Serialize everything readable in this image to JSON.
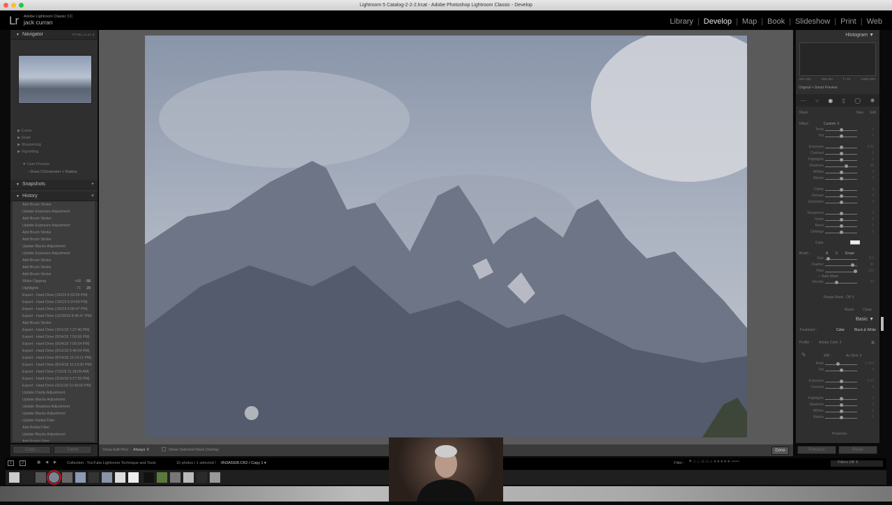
{
  "window": {
    "title": "Lightroom 5 Catalog-2-2-2.lrcat - Adobe Photoshop Lightroom Classic - Develop"
  },
  "identity": {
    "logo": "Lr",
    "app": "Adobe Lightroom Classic CC",
    "user": "jack curran"
  },
  "modules": [
    {
      "label": "Library"
    },
    {
      "label": "Develop",
      "active": true
    },
    {
      "label": "Map"
    },
    {
      "label": "Book"
    },
    {
      "label": "Slideshow"
    },
    {
      "label": "Print"
    },
    {
      "label": "Web"
    }
  ],
  "left": {
    "navigator": {
      "title": "Navigator",
      "zoom_options": "FIT  FILL  1:1  4:1 ⇕"
    },
    "sections": [
      "Curve",
      "Grain",
      "Sharpening",
      "Vignetting"
    ],
    "user_presets": {
      "title": "User Presets",
      "item": "Dune COnversion + Radius"
    },
    "snapshots": {
      "title": "Snapshots",
      "add": "+"
    },
    "history": {
      "title": "History",
      "close": "×",
      "items": [
        {
          "label": "Add Brush Stroke"
        },
        {
          "label": "Update Exposure Adjustment"
        },
        {
          "label": "Add Brush Stroke"
        },
        {
          "label": "Update Exposure Adjustment"
        },
        {
          "label": "Add Brush Stroke"
        },
        {
          "label": "Add Brush Stroke"
        },
        {
          "label": "Update Blacks Adjustment"
        },
        {
          "label": "Update Exposure Adjustment"
        },
        {
          "label": "Add Brush Stroke"
        },
        {
          "label": "Add Brush Stroke"
        },
        {
          "label": "Add Brush Stroke"
        },
        {
          "label": "White Clipping",
          "v1": "+68",
          "v2": "68"
        },
        {
          "label": "Highlights",
          "v1": "-71",
          "v2": "29"
        },
        {
          "label": "Export - Hard Drive (1/6/19 6:32:05 PM)"
        },
        {
          "label": "Export - Hard Drive (1/6/19 6:24:59 PM)"
        },
        {
          "label": "Export - Hard Drive (1/6/19 5:06:47 PM)"
        },
        {
          "label": "Export - Hard Drive (12/28/18 8:46:47 PM)"
        },
        {
          "label": "Add Brush Stroke"
        },
        {
          "label": "Export - Hard Drive (10/1/18 7:27:40 PM)"
        },
        {
          "label": "Export - Hard Drive (9/24/18 7:56:56 PM)"
        },
        {
          "label": "Export - Hard Drive (9/24/18 7:05:54 PM)"
        },
        {
          "label": "Export - Hard Drive (9/12/18 6:46:04 PM)"
        },
        {
          "label": "Export - Hard Drive (8/14/18 10:14:11 PM)"
        },
        {
          "label": "Export - Hard Drive (8/14/18 10:13:50 PM)"
        },
        {
          "label": "Export - Hard Drive (7/2/18 11:18:04 AM)"
        },
        {
          "label": "Export - Hard Drive (3/16/18 5:27:59 PM)"
        },
        {
          "label": "Export - Hard Drive (3/11/18 11:43:02 PM)"
        },
        {
          "label": "Update Clarity Adjustment"
        },
        {
          "label": "Update Blacks Adjustment"
        },
        {
          "label": "Update Shadows Adjustment"
        },
        {
          "label": "Update Blacks Adjustment"
        },
        {
          "label": "Update Radial Filter"
        },
        {
          "label": "Add Radial Filter"
        },
        {
          "label": "Update Blacks Adjustment"
        },
        {
          "label": "Add Radial Filter"
        }
      ]
    },
    "copy": "Copy...",
    "paste": "Paste"
  },
  "toolbar": {
    "edit_pins_label": "Show Edit Pins :",
    "edit_pins_value": "Always ⇕",
    "mask_overlay": "Show Selected Mask Overlay",
    "done": "Done"
  },
  "right": {
    "histogram": {
      "title": "Histogram",
      "iso": "ISO 100",
      "focal": "158 mm",
      "aperture": "f / 10",
      "shutter": "1/400 SEC",
      "preview": "Original + Smart Preview"
    },
    "mask": {
      "label": "Mask :",
      "new": "New",
      "edit": "Edit"
    },
    "effect": {
      "label": "Effect :",
      "value": "Custom ⇕"
    },
    "sliders": [
      {
        "label": "Temp",
        "pos": 0.5,
        "value": "0"
      },
      {
        "label": "Tint",
        "pos": 0.5,
        "value": "0"
      },
      {
        "label": "Exposure",
        "pos": 0.5,
        "value": "0.00"
      },
      {
        "label": "Contrast",
        "pos": 0.5,
        "value": "0"
      },
      {
        "label": "Highlights",
        "pos": 0.5,
        "value": "0"
      },
      {
        "label": "Shadows",
        "pos": 0.66,
        "value": "38"
      },
      {
        "label": "Whites",
        "pos": 0.5,
        "value": "0"
      },
      {
        "label": "Blacks",
        "pos": 0.5,
        "value": "0"
      },
      {
        "label": "Clarity",
        "pos": 0.5,
        "value": "0"
      },
      {
        "label": "Dehaze",
        "pos": 0.5,
        "value": "0"
      },
      {
        "label": "Saturation",
        "pos": 0.5,
        "value": "0"
      },
      {
        "label": "Sharpness",
        "pos": 0.5,
        "value": "0"
      },
      {
        "label": "Noise",
        "pos": 0.5,
        "value": "0"
      },
      {
        "label": "Moiré",
        "pos": 0.5,
        "value": "0"
      },
      {
        "label": "Defringe",
        "pos": 0.5,
        "value": "0"
      }
    ],
    "color_label": "Color",
    "brush": {
      "label": "Brush :",
      "a": "A",
      "b": "B",
      "erase": "Erase",
      "auto_mask": "Auto Mask",
      "sliders": [
        {
          "label": "Size",
          "pos": 0.1,
          "value": "8.6"
        },
        {
          "label": "Feather",
          "pos": 0.85,
          "value": "90"
        },
        {
          "label": "Flow",
          "pos": 0.95,
          "value": "100"
        },
        {
          "label": "Density",
          "pos": 0.35,
          "value": "33"
        }
      ]
    },
    "range_mask": "Range Mask : Off ⇕",
    "reset": "Reset",
    "close": "Close",
    "basic": {
      "title": "Basic",
      "treatment_label": "Treatment :",
      "color": "Color",
      "bw": "Black & White",
      "profile_label": "Profile :",
      "profile": "Adobe Color ⇕",
      "wb_label": "WB :",
      "wb": "As Shot ⇕",
      "tone": "Tone",
      "auto": "Auto",
      "presence": "Presence",
      "sliders": [
        {
          "label": "Temp",
          "pos": 0.4,
          "value": "5,200"
        },
        {
          "label": "Tint",
          "pos": 0.5,
          "value": "0"
        },
        {
          "label": "Exposure",
          "pos": 0.5,
          "value": "0.00"
        },
        {
          "label": "Contrast",
          "pos": 0.5,
          "value": "0"
        },
        {
          "label": "Highlights",
          "pos": 0.5,
          "value": "0"
        },
        {
          "label": "Shadows",
          "pos": 0.5,
          "value": "0"
        },
        {
          "label": "Whites",
          "pos": 0.5,
          "value": "0"
        },
        {
          "label": "Blacks",
          "pos": 0.5,
          "value": "0"
        }
      ]
    },
    "previous": "Previous",
    "reset_all": "Reset"
  },
  "filmstrip": {
    "view1": "1",
    "view2": "2",
    "collection": "Collection : YouTube Lightroom Technique and Tools",
    "count": "16 photos / 1 selected /",
    "filename": "0N3A5928.CR2 / Copy 1 ▾",
    "filter_label": "Filter :",
    "filters_off": "Filters Off ⇕",
    "thumbnails": 16,
    "selected_index": 3
  }
}
